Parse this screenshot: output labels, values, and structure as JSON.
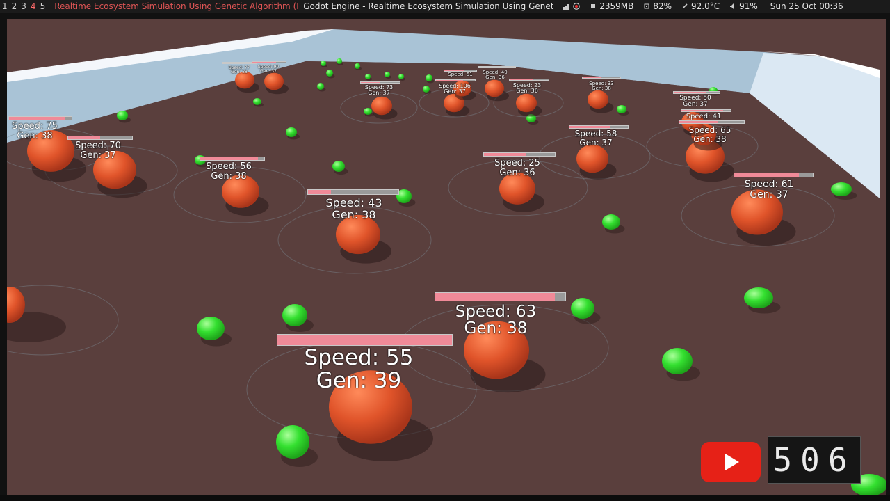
{
  "topbar": {
    "workspaces": [
      "1",
      "2",
      "3",
      "4",
      "5"
    ],
    "active_workspace": "4",
    "active_window_title": "Realtime Ecosystem Simulation Using Genetic Algorithm (D...",
    "other_window_title": "Godot Engine - Realtime Ecosystem Simulation Using Genet...",
    "memory": "2359MB",
    "cpu": "82%",
    "temperature": "92.0°C",
    "volume": "91%",
    "clock": "Sun 25 Oct 00:36"
  },
  "icons": {
    "memory": "memory-icon",
    "cpu": "cpu-icon",
    "temperature": "thermometer-icon",
    "volume": "volume-icon",
    "network": "network-icon",
    "youtube": "youtube-play-icon"
  },
  "colors": {
    "ground": "#5a3f3d",
    "wall": "#a9c3d6",
    "creature": "#e0542a",
    "food": "#34e030",
    "health_fill": "#f08a98",
    "youtube_red": "#e62117"
  },
  "creatures": [
    {
      "speed_label": "Speed: 55",
      "gen_label": "Gen: 39"
    },
    {
      "speed_label": "Speed: 63",
      "gen_label": "Gen: 38"
    },
    {
      "speed_label": "Speed: 43",
      "gen_label": "Gen: 38"
    },
    {
      "speed_label": "Speed: 56",
      "gen_label": "Gen: 38"
    },
    {
      "speed_label": "Speed: 25",
      "gen_label": "Gen: 36"
    },
    {
      "speed_label": "Speed: 61",
      "gen_label": "Gen: 37"
    },
    {
      "speed_label": "Speed: 70",
      "gen_label": "Gen: 37"
    },
    {
      "speed_label": "Speed: 75",
      "gen_label": "Gen: 38"
    },
    {
      "speed_label": "Speed: 58",
      "gen_label": "Gen: 37"
    },
    {
      "speed_label": "Speed: 65",
      "gen_label": "Gen: 38"
    },
    {
      "speed_label": "Speed: 41",
      "gen_label": ""
    },
    {
      "speed_label": "Speed: 50",
      "gen_label": "Gen: 37"
    },
    {
      "speed_label": "Speed: 73",
      "gen_label": "Gen: 37"
    },
    {
      "speed_label": "Speed: 23",
      "gen_label": "Gen: 36"
    },
    {
      "speed_label": "Speed: 106",
      "gen_label": "Gen: 37"
    },
    {
      "speed_label": "Speed: 51",
      "gen_label": ""
    },
    {
      "speed_label": "Speed: 40",
      "gen_label": "Gen: 36"
    },
    {
      "speed_label": "Speed: 33",
      "gen_label": "Gen: 38"
    },
    {
      "speed_label": "Speed: 77",
      "gen_label": "Gen: 38"
    },
    {
      "speed_label": "Speed: 90",
      "gen_label": "Gen: 37"
    }
  ],
  "health_levels": [
    1.0,
    0.92,
    0.25,
    0.9,
    0.6,
    0.82,
    0.5,
    0.9,
    0.7,
    0.6,
    0.85,
    0.7,
    0.5,
    0.6,
    0.7,
    0.6,
    0.6,
    0.5,
    0.7,
    0.7
  ],
  "overlay": {
    "counter": "506"
  }
}
